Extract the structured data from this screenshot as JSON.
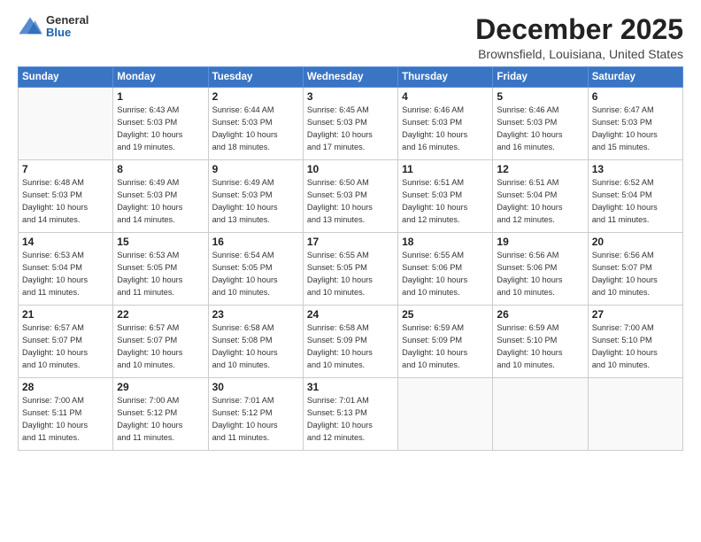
{
  "header": {
    "logo_general": "General",
    "logo_blue": "Blue",
    "title": "December 2025",
    "subtitle": "Brownsfield, Louisiana, United States"
  },
  "weekdays": [
    "Sunday",
    "Monday",
    "Tuesday",
    "Wednesday",
    "Thursday",
    "Friday",
    "Saturday"
  ],
  "weeks": [
    [
      {
        "day": "",
        "info": ""
      },
      {
        "day": "1",
        "info": "Sunrise: 6:43 AM\nSunset: 5:03 PM\nDaylight: 10 hours\nand 19 minutes."
      },
      {
        "day": "2",
        "info": "Sunrise: 6:44 AM\nSunset: 5:03 PM\nDaylight: 10 hours\nand 18 minutes."
      },
      {
        "day": "3",
        "info": "Sunrise: 6:45 AM\nSunset: 5:03 PM\nDaylight: 10 hours\nand 17 minutes."
      },
      {
        "day": "4",
        "info": "Sunrise: 6:46 AM\nSunset: 5:03 PM\nDaylight: 10 hours\nand 16 minutes."
      },
      {
        "day": "5",
        "info": "Sunrise: 6:46 AM\nSunset: 5:03 PM\nDaylight: 10 hours\nand 16 minutes."
      },
      {
        "day": "6",
        "info": "Sunrise: 6:47 AM\nSunset: 5:03 PM\nDaylight: 10 hours\nand 15 minutes."
      }
    ],
    [
      {
        "day": "7",
        "info": "Sunrise: 6:48 AM\nSunset: 5:03 PM\nDaylight: 10 hours\nand 14 minutes."
      },
      {
        "day": "8",
        "info": "Sunrise: 6:49 AM\nSunset: 5:03 PM\nDaylight: 10 hours\nand 14 minutes."
      },
      {
        "day": "9",
        "info": "Sunrise: 6:49 AM\nSunset: 5:03 PM\nDaylight: 10 hours\nand 13 minutes."
      },
      {
        "day": "10",
        "info": "Sunrise: 6:50 AM\nSunset: 5:03 PM\nDaylight: 10 hours\nand 13 minutes."
      },
      {
        "day": "11",
        "info": "Sunrise: 6:51 AM\nSunset: 5:03 PM\nDaylight: 10 hours\nand 12 minutes."
      },
      {
        "day": "12",
        "info": "Sunrise: 6:51 AM\nSunset: 5:04 PM\nDaylight: 10 hours\nand 12 minutes."
      },
      {
        "day": "13",
        "info": "Sunrise: 6:52 AM\nSunset: 5:04 PM\nDaylight: 10 hours\nand 11 minutes."
      }
    ],
    [
      {
        "day": "14",
        "info": "Sunrise: 6:53 AM\nSunset: 5:04 PM\nDaylight: 10 hours\nand 11 minutes."
      },
      {
        "day": "15",
        "info": "Sunrise: 6:53 AM\nSunset: 5:05 PM\nDaylight: 10 hours\nand 11 minutes."
      },
      {
        "day": "16",
        "info": "Sunrise: 6:54 AM\nSunset: 5:05 PM\nDaylight: 10 hours\nand 10 minutes."
      },
      {
        "day": "17",
        "info": "Sunrise: 6:55 AM\nSunset: 5:05 PM\nDaylight: 10 hours\nand 10 minutes."
      },
      {
        "day": "18",
        "info": "Sunrise: 6:55 AM\nSunset: 5:06 PM\nDaylight: 10 hours\nand 10 minutes."
      },
      {
        "day": "19",
        "info": "Sunrise: 6:56 AM\nSunset: 5:06 PM\nDaylight: 10 hours\nand 10 minutes."
      },
      {
        "day": "20",
        "info": "Sunrise: 6:56 AM\nSunset: 5:07 PM\nDaylight: 10 hours\nand 10 minutes."
      }
    ],
    [
      {
        "day": "21",
        "info": "Sunrise: 6:57 AM\nSunset: 5:07 PM\nDaylight: 10 hours\nand 10 minutes."
      },
      {
        "day": "22",
        "info": "Sunrise: 6:57 AM\nSunset: 5:07 PM\nDaylight: 10 hours\nand 10 minutes."
      },
      {
        "day": "23",
        "info": "Sunrise: 6:58 AM\nSunset: 5:08 PM\nDaylight: 10 hours\nand 10 minutes."
      },
      {
        "day": "24",
        "info": "Sunrise: 6:58 AM\nSunset: 5:09 PM\nDaylight: 10 hours\nand 10 minutes."
      },
      {
        "day": "25",
        "info": "Sunrise: 6:59 AM\nSunset: 5:09 PM\nDaylight: 10 hours\nand 10 minutes."
      },
      {
        "day": "26",
        "info": "Sunrise: 6:59 AM\nSunset: 5:10 PM\nDaylight: 10 hours\nand 10 minutes."
      },
      {
        "day": "27",
        "info": "Sunrise: 7:00 AM\nSunset: 5:10 PM\nDaylight: 10 hours\nand 10 minutes."
      }
    ],
    [
      {
        "day": "28",
        "info": "Sunrise: 7:00 AM\nSunset: 5:11 PM\nDaylight: 10 hours\nand 11 minutes."
      },
      {
        "day": "29",
        "info": "Sunrise: 7:00 AM\nSunset: 5:12 PM\nDaylight: 10 hours\nand 11 minutes."
      },
      {
        "day": "30",
        "info": "Sunrise: 7:01 AM\nSunset: 5:12 PM\nDaylight: 10 hours\nand 11 minutes."
      },
      {
        "day": "31",
        "info": "Sunrise: 7:01 AM\nSunset: 5:13 PM\nDaylight: 10 hours\nand 12 minutes."
      },
      {
        "day": "",
        "info": ""
      },
      {
        "day": "",
        "info": ""
      },
      {
        "day": "",
        "info": ""
      }
    ]
  ]
}
